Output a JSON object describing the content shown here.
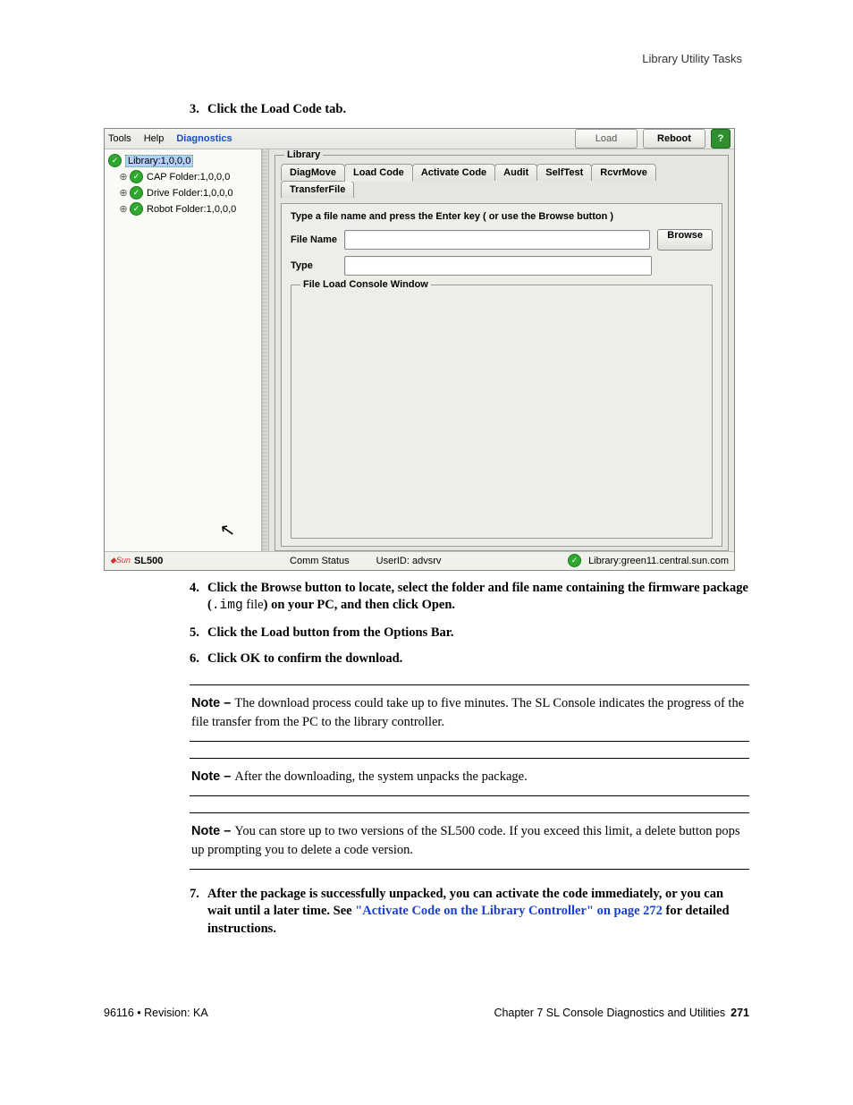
{
  "running_head": "Library Utility Tasks",
  "steps": {
    "s3": {
      "num": "3.",
      "text": "Click the Load Code tab."
    },
    "s4": {
      "num": "4.",
      "pre": "Click the Browse button to locate, select the folder and file name containing the firmware package (",
      "mono": ".img",
      "mid": " file",
      "post": ") on your PC, and then click Open."
    },
    "s5": {
      "num": "5.",
      "text": "Click the Load button from the Options Bar."
    },
    "s6": {
      "num": "6.",
      "text": "Click OK to confirm the download."
    },
    "s7": {
      "num": "7.",
      "pre": "After the package is successfully unpacked, you can activate the code immediately, or you can wait until a later time. See ",
      "link": "\"Activate Code on the Library Controller\" on page 272",
      "post": " for detailed instructions."
    }
  },
  "notes": {
    "label": "Note – ",
    "n1": "The download process could take up to five minutes. The SL Console indicates the progress of the file transfer from the PC to the library controller.",
    "n2": "After the downloading, the system unpacks the package.",
    "n3": "You can store up to two versions of the SL500 code. If you exceed this limit, a delete button pops up prompting you to delete a code version."
  },
  "screenshot": {
    "menubar": {
      "tools": "Tools",
      "help": "Help",
      "diagnostics": "Diagnostics"
    },
    "toolbar": {
      "load": "Load",
      "reboot": "Reboot",
      "help": "?"
    },
    "tree": {
      "root": "Library:1,0,0,0",
      "cap": "CAP Folder:1,0,0,0",
      "drive": "Drive Folder:1,0,0,0",
      "robot": "Robot Folder:1,0,0,0"
    },
    "panel": {
      "legend": "Library",
      "tabs": {
        "diagmove": "DiagMove",
        "loadcode": "Load Code",
        "activate": "Activate Code",
        "audit": "Audit",
        "selftest": "SelfTest",
        "rcvrmove": "RcvrMove",
        "transferfile": "TransferFile"
      },
      "instruction": "Type a file name and press the Enter key ( or use the Browse button )",
      "labels": {
        "filename": "File Name",
        "type": "Type"
      },
      "browse": "Browse",
      "console_legend": "File Load Console Window"
    },
    "statusbar": {
      "product": "SL500",
      "comm": "Comm Status",
      "userid": "UserID: advsrv",
      "library": "Library:green11.central.sun.com"
    }
  },
  "footer": {
    "left": "96116 • Revision: KA",
    "right_text": "Chapter 7 SL Console Diagnostics and Utilities",
    "right_page": "271"
  }
}
